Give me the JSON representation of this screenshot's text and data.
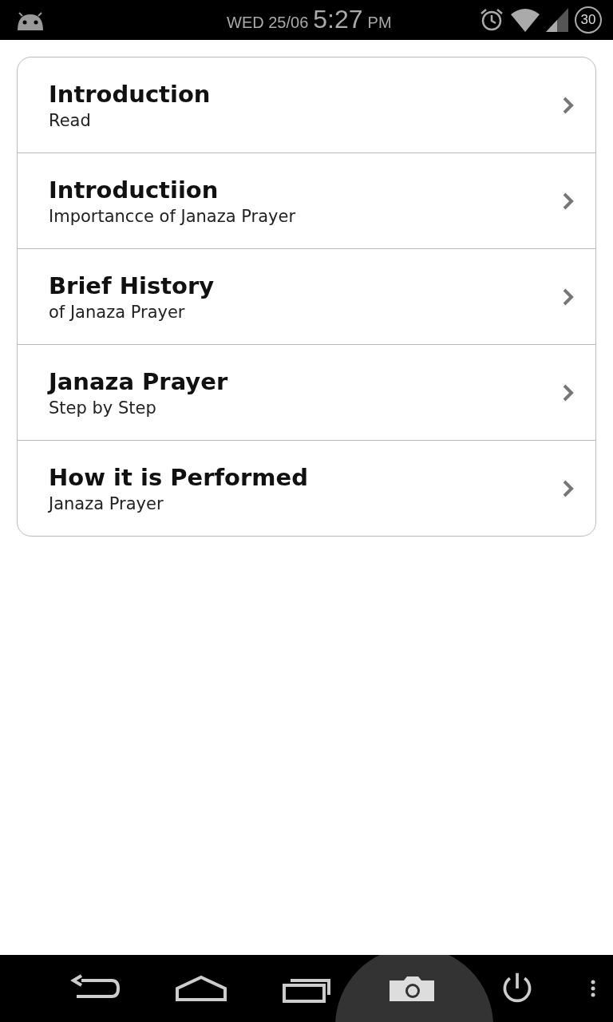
{
  "status_bar": {
    "date": "WED 25/06",
    "time": "5:27",
    "ampm": "PM",
    "battery": "30"
  },
  "menu": [
    {
      "title": "Introduction",
      "subtitle": "Read"
    },
    {
      "title": "Introductiion",
      "subtitle": "Importancce of Janaza Prayer"
    },
    {
      "title": "Brief History",
      "subtitle": "of Janaza Prayer"
    },
    {
      "title": "Janaza Prayer",
      "subtitle": "Step by Step"
    },
    {
      "title": "How it is Performed",
      "subtitle": "Janaza Prayer"
    }
  ]
}
